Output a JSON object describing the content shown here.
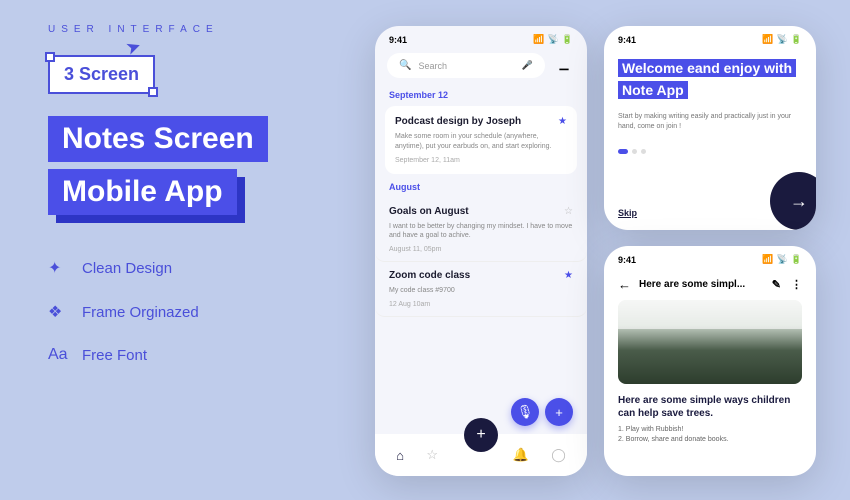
{
  "left": {
    "eyebrow": "USER INTERFACE",
    "badge": "3 Screen",
    "title_line1": "Notes Screen",
    "title_line2": "Mobile App",
    "features": [
      "Clean Design",
      "Frame Orginazed",
      "Free Font"
    ]
  },
  "phone_main": {
    "time": "9:41",
    "search_placeholder": "Search",
    "sections": [
      {
        "label": "September 12",
        "notes": [
          {
            "title": "Podcast design by Joseph",
            "body": "Make some room in your schedule (anywhere, anytime), put your earbuds on, and start exploring.",
            "date": "September 12, 11am",
            "starred": true
          }
        ]
      },
      {
        "label": "August",
        "notes": [
          {
            "title": "Goals on August",
            "body": "I want to be better by changing my mindset. I have to move and have a goal to achive.",
            "date": "August 11, 05pm",
            "starred": false
          },
          {
            "title": "Zoom code class",
            "body": "My code class #9700",
            "date": "12 Aug 10am",
            "starred": true
          }
        ]
      }
    ]
  },
  "phone_onboard": {
    "time": "9:41",
    "hero": "Welcome eand enjoy with Note App",
    "sub": "Start by making writing easily and practically just in your hand, come on join !",
    "skip": "Skip"
  },
  "phone_detail": {
    "time": "9:41",
    "header": "Here are some simpl...",
    "title": "Here are some simple ways children can help save trees.",
    "list": [
      "1. Play with Rubbish!",
      "2. Borrow, share and donate books."
    ]
  }
}
